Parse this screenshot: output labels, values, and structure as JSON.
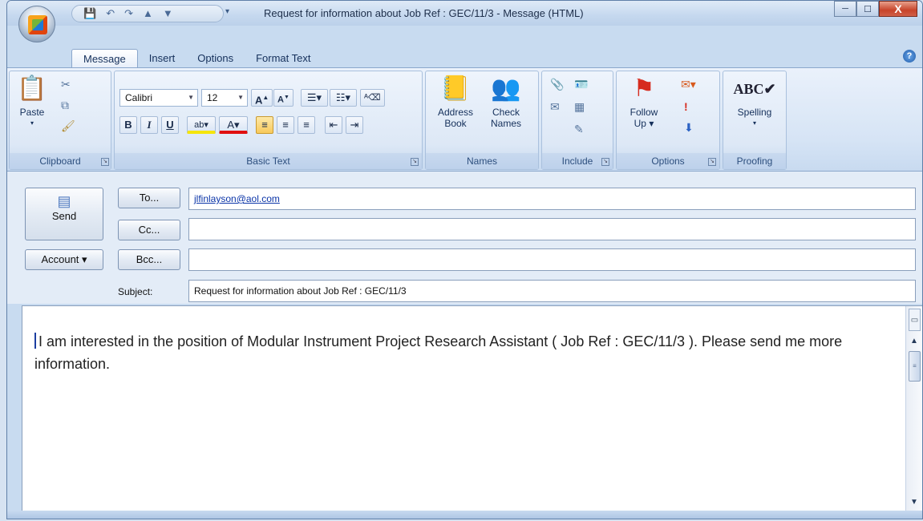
{
  "window": {
    "title": "Request for information about Job Ref : GEC/11/3 - Message (HTML)",
    "minimize": "─",
    "maximize": "☐",
    "close": "X"
  },
  "quick_access": {
    "save": "💾",
    "undo": "↶",
    "redo": "↷",
    "up": "▲",
    "down": "▼",
    "more": "▾"
  },
  "tabs": [
    "Message",
    "Insert",
    "Options",
    "Format Text"
  ],
  "active_tab": "Message",
  "help_icon": "?",
  "ribbon": {
    "clipboard": {
      "label": "Clipboard",
      "paste": "Paste"
    },
    "basic_text": {
      "label": "Basic Text",
      "font": "Calibri",
      "size": "12",
      "bold": "B",
      "italic": "I",
      "underline": "U"
    },
    "names": {
      "label": "Names",
      "address_book_1": "Address",
      "address_book_2": "Book",
      "check_names_1": "Check",
      "check_names_2": "Names"
    },
    "include": {
      "label": "Include"
    },
    "options": {
      "label": "Options",
      "follow_up_1": "Follow",
      "follow_up_2": "Up ▾"
    },
    "proofing": {
      "label": "Proofing",
      "spelling": "Spelling"
    }
  },
  "form": {
    "send": "Send",
    "account": "Account ▾",
    "to_button": "To...",
    "cc_button": "Cc...",
    "bcc_button": "Bcc...",
    "subject_label": "Subject:",
    "to_value": "jlfinlayson@aol.com",
    "cc_value": "",
    "bcc_value": "",
    "subject_value": "Request for information about Job Ref : GEC/11/3"
  },
  "body": {
    "text": "I am interested in the position of Modular Instrument Project Research Assistant ( Job Ref : GEC/11/3 ). Please send me more information."
  },
  "colors": {
    "accent": "#c8dbf0",
    "link": "#0b35a8",
    "highlight": "#f8c95a",
    "font_color_bar": "#e01010",
    "highlight_bar": "#f5e50a"
  }
}
